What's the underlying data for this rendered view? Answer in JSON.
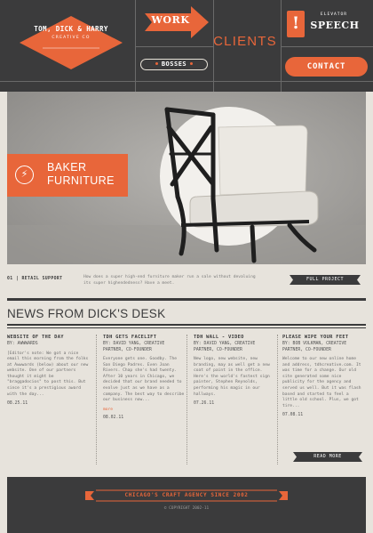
{
  "colors": {
    "accent": "#e8663a",
    "dark": "#3b3b3c",
    "paper": "#e7e3dc"
  },
  "header": {
    "logo": {
      "name": "TOM, DICK & HARRY",
      "subtitle": "CREATIVE CO"
    },
    "nav": {
      "work": "WORK",
      "bosses": "BOSSES",
      "clients": "CLIENTS",
      "elevator_label": "ELEVATOR",
      "speech": "SPEECH",
      "exclamation": "!",
      "contact": "CONTACT"
    }
  },
  "hero": {
    "title_line1": "BAKER",
    "title_line2": "FURNITURE",
    "icon": "lightning-icon"
  },
  "feature_strip": {
    "number": "01 | RETAIL SUPPORT",
    "description": "How does a super high-end furniture maker run a sale without devaluing its super highendedness? Have a meet.",
    "button": "FULL PROJECT"
  },
  "news": {
    "heading": "NEWS FROM DICK'S DESK",
    "posts": [
      {
        "title": "WEBSITE OF THE DAY",
        "author": "BY: AWWWARDS",
        "body": "[Editor's note: We got a nice email this morning from the folks at Awwwards (below) about our new website. One of our partners thought it might be \"braggadocios\" to post this. But since it's a prestigious award with the day...",
        "more": "",
        "date": "08.25.11"
      },
      {
        "title": "TDH GETS FACELIFT",
        "author": "BY: DAVID YANG, CREATIVE PARTNER, CO-FOUNDER",
        "body": "Everyone gets one. Goodby. The San Diego Padres. Even Joan Rivers. Chap she's had twenty. After 10 years in Chicago, we decided that our brand needed to evolve just as we have as a company. The best way to describe our business now...",
        "more": "more",
        "date": "08.02.11"
      },
      {
        "title": "TDH WALL - VIDEO",
        "author": "BY: DAVID YANG, CREATIVE PARTNER, CO-FOUNDER",
        "body": "New logo, new website, new branding, may as well get a new coat of paint in the office. Here's the world's fastest sign painter, Stephen Reynolds, performing his magic in our hallways.",
        "more": "",
        "date": "07.26.11"
      },
      {
        "title": "PLEASE WIPE YOUR FEET",
        "author": "BY: BOB VOLKMAN, CREATIVE PARTNER, CO-FOUNDER",
        "body": "Welcome to our new online home and address, tdhcreative.com. It was time for a change. Our old site generated some nice publicity for the agency and served us well. But it was flash based and started to feel a little old school. Plus, we got tire...",
        "more": "",
        "date": "07.08.11"
      }
    ],
    "read_more": "READ MORE"
  },
  "footer": {
    "banner": "CHICAGO'S CRAFT AGENCY SINCE 2002",
    "copyright": "© COPYRIGHT 2002-11"
  }
}
